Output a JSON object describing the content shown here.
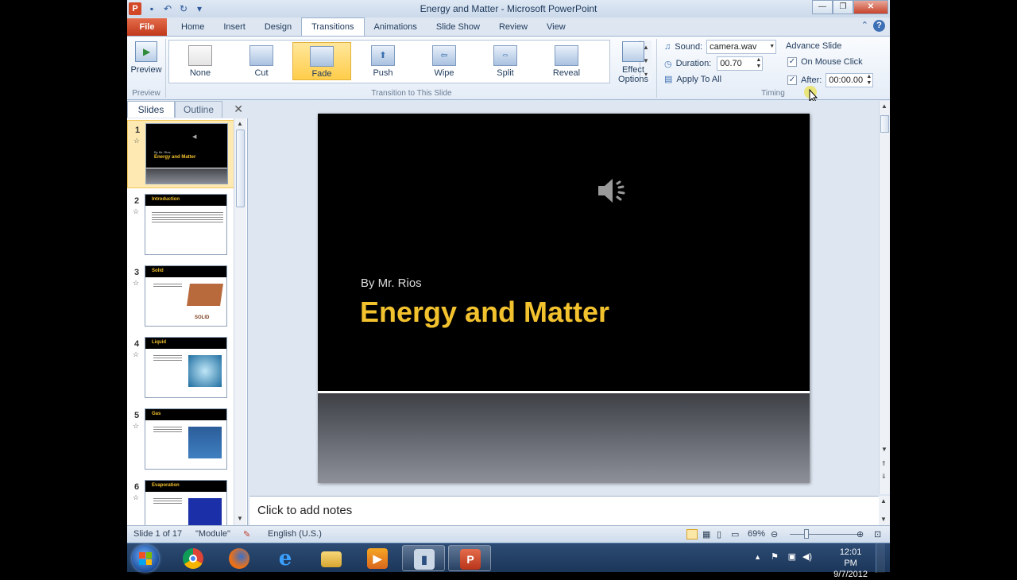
{
  "window": {
    "title": "Energy and Matter  -  Microsoft PowerPoint",
    "app_icon": "P"
  },
  "tabs": [
    "File",
    "Home",
    "Insert",
    "Design",
    "Transitions",
    "Animations",
    "Slide Show",
    "Review",
    "View"
  ],
  "active_tab": "Transitions",
  "ribbon": {
    "preview": {
      "label": "Preview",
      "group": "Preview"
    },
    "transitions": {
      "group": "Transition to This Slide",
      "items": [
        {
          "label": "None",
          "icon": "none"
        },
        {
          "label": "Cut",
          "icon": "cut"
        },
        {
          "label": "Fade",
          "icon": "fade",
          "selected": true
        },
        {
          "label": "Push",
          "icon": "push"
        },
        {
          "label": "Wipe",
          "icon": "wipe"
        },
        {
          "label": "Split",
          "icon": "split"
        },
        {
          "label": "Reveal",
          "icon": "reveal"
        }
      ],
      "effect_options_line1": "Effect",
      "effect_options_line2": "Options"
    },
    "timing": {
      "group": "Timing",
      "sound_label": "Sound:",
      "sound_value": "camera.wav",
      "duration_label": "Duration:",
      "duration_value": "00.70",
      "apply_all": "Apply To All",
      "advance_title": "Advance Slide",
      "on_mouse_click": "On Mouse Click",
      "on_mouse_click_checked": true,
      "after_label": "After:",
      "after_checked": true,
      "after_value": "00:00.00"
    }
  },
  "slides_pane": {
    "tabs": [
      "Slides",
      "Outline"
    ],
    "slides": [
      {
        "num": "1",
        "title": "Energy and Matter",
        "subtitle": "By Mr. Rios",
        "selected": true
      },
      {
        "num": "2",
        "title": "Introduction"
      },
      {
        "num": "3",
        "title": "Solid",
        "pic_label": "SOLID"
      },
      {
        "num": "4",
        "title": "Liquid"
      },
      {
        "num": "5",
        "title": "Gas"
      },
      {
        "num": "6",
        "title": "Evaporation"
      }
    ]
  },
  "slide": {
    "subtitle": "By Mr. Rios",
    "title": "Energy and Matter"
  },
  "notes": {
    "placeholder": "Click to add notes"
  },
  "status": {
    "slide_info": "Slide 1 of 17",
    "theme": "\"Module\"",
    "language": "English (U.S.)",
    "zoom": "69%",
    "zoom_fraction": 0.69
  },
  "taskbar": {
    "time": "12:01 PM",
    "date": "9/7/2012",
    "items": [
      "start",
      "chrome",
      "firefox",
      "internet-explorer",
      "file-explorer",
      "media",
      "film",
      "powerpoint"
    ]
  }
}
